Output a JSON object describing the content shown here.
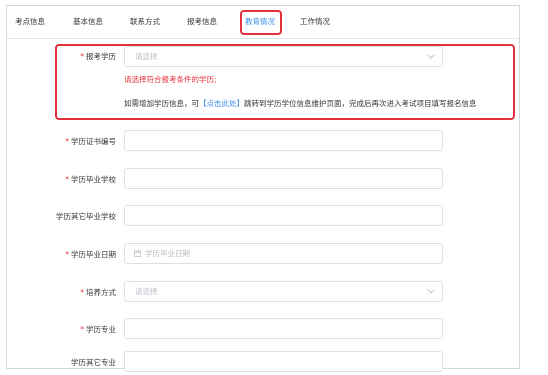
{
  "tabs": [
    {
      "label": "考点信息"
    },
    {
      "label": "基本信息"
    },
    {
      "label": "联系方式"
    },
    {
      "label": "报考信息"
    },
    {
      "label": "教育情况"
    },
    {
      "label": "工作情况"
    }
  ],
  "active_tab": "教育情况",
  "form": {
    "education_level": {
      "label": "报考学历",
      "placeholder": "请选择"
    },
    "error_message": "请选择符合报考条件的学历;",
    "info_message": {
      "prefix": "如需增加学历信息，可",
      "link": "【点击此处】",
      "suffix": "跳转到学历学位信息维护页面，完成后再次进入考试项目填写报名信息"
    },
    "certificate_number": {
      "label": "学历证书编号"
    },
    "graduation_school": {
      "label": "学历毕业学校"
    },
    "other_school": {
      "label": "学历其它毕业学校"
    },
    "graduation_date": {
      "label": "学历毕业日期",
      "placeholder": "学历毕业日期"
    },
    "training_mode": {
      "label": "培养方式",
      "placeholder": "请选择"
    },
    "major": {
      "label": "学历专业"
    },
    "other_major": {
      "label": "学历其它专业"
    }
  },
  "colors": {
    "required": "#e4303a",
    "accent": "#3a8ee6",
    "highlight_border": "#e4303a"
  }
}
